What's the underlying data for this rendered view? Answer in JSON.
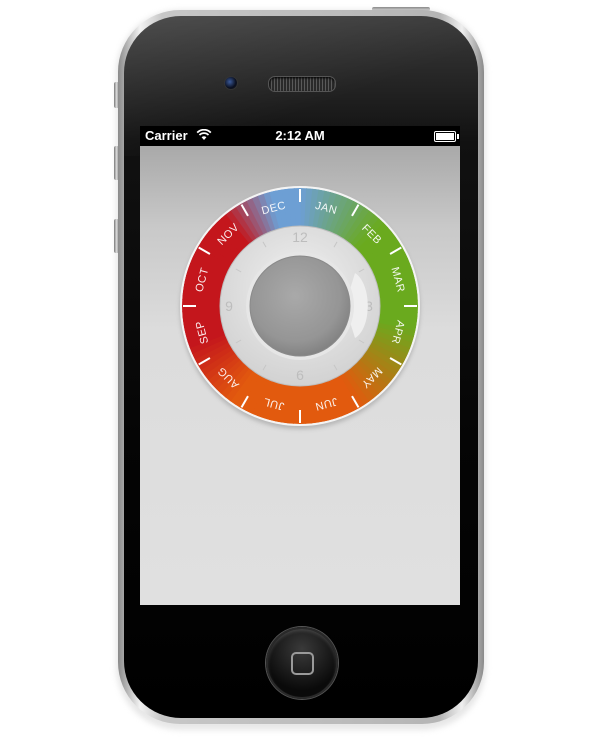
{
  "status_bar": {
    "carrier": "Carrier",
    "time": "2:12 AM",
    "battery_level": 1.0
  },
  "dial": {
    "months": [
      "JAN",
      "FEB",
      "MAR",
      "APR",
      "MAY",
      "JUN",
      "JUL",
      "AUG",
      "SEP",
      "OCT",
      "NOV",
      "DEC"
    ],
    "hour_labels": [
      "12",
      "3",
      "6",
      "9"
    ],
    "colors": {
      "green": "#6aaa1e",
      "orange": "#e25a0e",
      "red": "#c4161c",
      "blue": "#6d9fd4",
      "ring_face": "#d8d8d8",
      "knob": "#9a9a9a"
    }
  },
  "icons": {
    "wifi": "wifi-icon",
    "battery": "battery-icon",
    "home": "home-square-icon"
  }
}
